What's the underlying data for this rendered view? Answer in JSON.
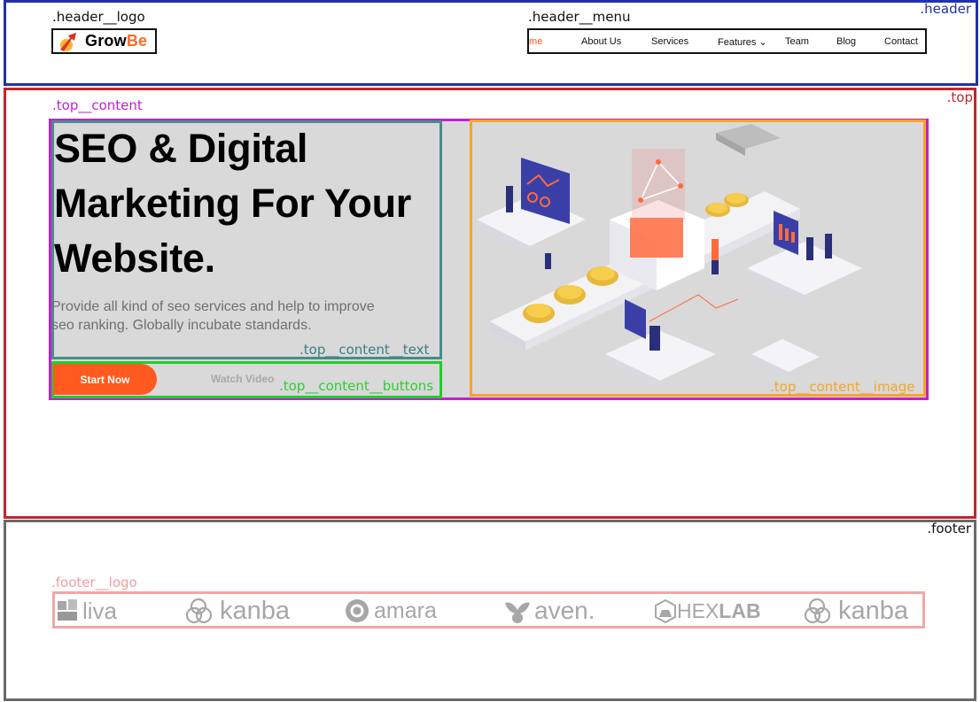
{
  "header": {
    "tag": ".header",
    "logo_tag": ".header__logo",
    "menu_tag": ".header__menu",
    "logo": {
      "text_main": "Grow",
      "text_accent": "Be",
      "accent_color": "#ff6a2a"
    },
    "menu": [
      {
        "label": "Home",
        "active": true
      },
      {
        "label": "About Us"
      },
      {
        "label": "Services"
      },
      {
        "label": "Features ⌄"
      },
      {
        "label": "Team"
      },
      {
        "label": "Blog"
      },
      {
        "label": "Contact"
      }
    ]
  },
  "top": {
    "tag": ".top",
    "content_tag": ".top__content",
    "text_tag": ".top__content__text",
    "buttons_tag": ".top__content__buttons",
    "image_tag": ".top__content__image",
    "headline_lines": [
      "SEO & Digital",
      "Marketing For Your",
      "Website."
    ],
    "subtext_lines": [
      "Provide all kind of seo services and help to improve",
      "seo ranking. Globally incubate standards."
    ],
    "primary_button": "Start Now",
    "secondary_button": "Watch Video",
    "accent_color": "#ff5a1f"
  },
  "footer": {
    "tag": ".footer",
    "logo_tag": ".footer__logo",
    "brands": [
      "liva",
      "kanba",
      "amara",
      "aven.",
      "HEX",
      "LAB",
      "kanba"
    ]
  }
}
